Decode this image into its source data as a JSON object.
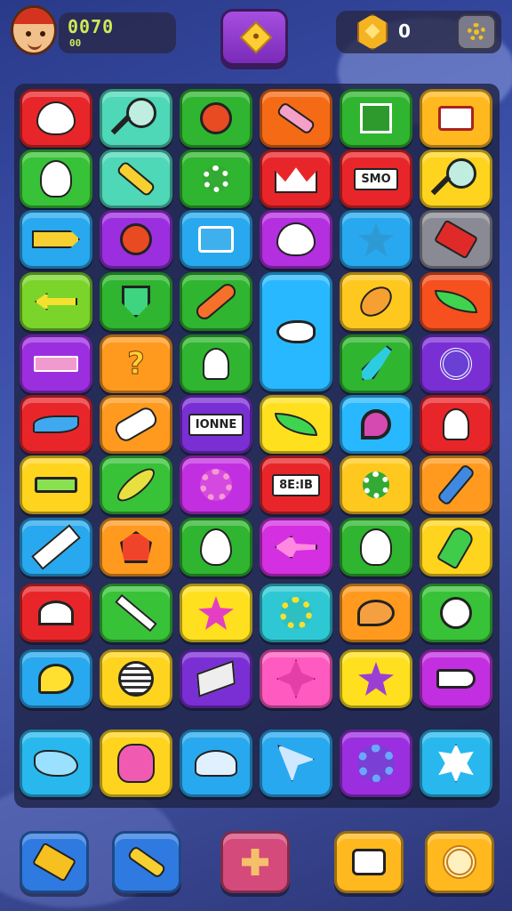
{
  "header": {
    "score": "0070",
    "score_sub": "00",
    "coins": "0",
    "avatar_icon": "chef-avatar",
    "center_button_icon": "diamond-icon",
    "coin_icon": "gold-hexagon-coin-icon",
    "settings_icon": "gear-icon"
  },
  "board": {
    "tiles": [
      {
        "icon": "heart-icon",
        "color": "#e8262a"
      },
      {
        "icon": "magnifier-icon",
        "color": "#4ed8b8"
      },
      {
        "icon": "pushpin-icon",
        "color": "#2fb52f"
      },
      {
        "icon": "pen-icon",
        "color": "#f56a14"
      },
      {
        "icon": "frame-icon",
        "color": "#2fb52f"
      },
      {
        "icon": "card-icon",
        "color": "#ffb81e"
      },
      {
        "icon": "lightbulb-icon",
        "color": "#38c238"
      },
      {
        "icon": "paperclip-icon",
        "color": "#4ed8b8"
      },
      {
        "icon": "gear-icon",
        "color": "#2fb52f"
      },
      {
        "icon": "crown-icon",
        "color": "#e8262a"
      },
      {
        "icon": "label-icon",
        "text": "SMO",
        "color": "#e8262a"
      },
      {
        "icon": "magnifier-icon",
        "color": "#ffd41e"
      },
      {
        "icon": "pencil-icon",
        "color": "#28a8ee"
      },
      {
        "icon": "pushpin-icon",
        "color": "#9b2fe0"
      },
      {
        "icon": "music-note-icon",
        "color": "#28a8ee"
      },
      {
        "icon": "heart-icon",
        "color": "#b32fe0"
      },
      {
        "icon": "star-icon",
        "color": "#28a8ee"
      },
      {
        "icon": "hammer-icon",
        "color": "#8a8a94"
      },
      {
        "icon": "arrow-back-icon",
        "color": "#7ad42a"
      },
      {
        "icon": "shield-icon",
        "color": "#2fb52f"
      },
      {
        "icon": "carrot-icon",
        "color": "#2fb52f"
      },
      {
        "icon": "fish-icon",
        "color": "#28b8ff"
      },
      {
        "icon": "mace-icon",
        "color": "#ffc81e"
      },
      {
        "icon": "leaf-icon",
        "color": "#f5501e"
      },
      {
        "icon": "bar-icon",
        "color": "#9b2fe0"
      },
      {
        "icon": "question-icon",
        "color": "#ff9a1e"
      },
      {
        "icon": "ghost-icon",
        "color": "#2fb52f"
      },
      {
        "icon": "dart-icon",
        "color": "#2fb52f"
      },
      {
        "icon": "spiral-icon",
        "color": "#7a2fd4"
      },
      {
        "icon": "wave-icon",
        "color": "#e8262a"
      },
      {
        "icon": "bandaid-icon",
        "color": "#ff9a1e"
      },
      {
        "icon": "label-icon",
        "text": "IONNE",
        "color": "#7a2fd4"
      },
      {
        "icon": "leaf-icon",
        "color": "#ffe01e"
      },
      {
        "icon": "location-pin-icon",
        "color": "#28b8ff"
      },
      {
        "icon": "ghost-icon",
        "color": "#e8262a"
      },
      {
        "icon": "battery-icon",
        "color": "#ffd41e"
      },
      {
        "icon": "banana-icon",
        "color": "#38c238"
      },
      {
        "icon": "flower-icon",
        "color": "#c22fe0"
      },
      {
        "icon": "label-icon",
        "text": "8E:IB",
        "color": "#e8262a"
      },
      {
        "icon": "gear-icon",
        "color": "#ffc81e"
      },
      {
        "icon": "wrench-icon",
        "color": "#ff9a1e"
      },
      {
        "icon": "ruler-icon",
        "color": "#28a8ee"
      },
      {
        "icon": "badge-icon",
        "color": "#ff9a1e"
      },
      {
        "icon": "egg-icon",
        "color": "#2fb52f"
      },
      {
        "icon": "airplane-icon",
        "color": "#d42fe0"
      },
      {
        "icon": "lightbulb-icon",
        "color": "#2fb52f"
      },
      {
        "icon": "microphone-icon",
        "color": "#ffd41e"
      },
      {
        "icon": "eye-icon",
        "color": "#e8262a"
      },
      {
        "icon": "knife-icon",
        "color": "#38c238"
      },
      {
        "icon": "star-icon",
        "color": "#ffe01e"
      },
      {
        "icon": "sun-icon",
        "color": "#2ec8d4"
      },
      {
        "icon": "chat-bubble-icon",
        "color": "#ff9a1e"
      },
      {
        "icon": "face-icon",
        "color": "#38c238"
      },
      {
        "icon": "speech-bubble-icon",
        "color": "#28a8ee"
      },
      {
        "icon": "vent-icon",
        "color": "#ffd41e"
      },
      {
        "icon": "eraser-icon",
        "color": "#7a2fd4"
      },
      {
        "icon": "flower-icon",
        "color": "#ff5ac0"
      },
      {
        "icon": "star-icon",
        "color": "#ffe01e"
      },
      {
        "icon": "tag-icon",
        "color": "#c22fe0"
      },
      {
        "icon": "dinosaur-icon",
        "color": "#28b8ee"
      },
      {
        "icon": "glove-icon",
        "color": "#ffd41e"
      },
      {
        "icon": "mushroom-icon",
        "color": "#28a8ee"
      },
      {
        "icon": "cursor-icon",
        "color": "#28a8ee"
      },
      {
        "icon": "cog-icon",
        "color": "#9b2fe0"
      },
      {
        "icon": "splat-icon",
        "color": "#28b8ee"
      }
    ]
  },
  "powerups": [
    {
      "icon": "hammer-icon",
      "color": "#2f7ae0"
    },
    {
      "icon": "pen-icon",
      "color": "#2f7ae0"
    },
    {
      "icon": "plus-icon",
      "color": "#d44a7a"
    },
    {
      "icon": "shuffle-icon",
      "color": "#ffb81e"
    },
    {
      "icon": "target-icon",
      "color": "#ffb81e"
    }
  ]
}
